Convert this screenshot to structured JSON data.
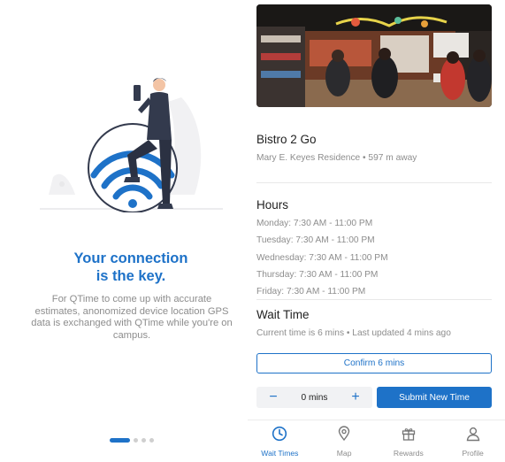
{
  "onboarding": {
    "title_line1": "Your connection",
    "title_line2": "is the key.",
    "body": "For QTime to come up with accurate estimates, anonomized device location GPS data is exchanged with QTime while you're on campus.",
    "pagination": {
      "count": 4,
      "active_index": 0
    }
  },
  "restaurant": {
    "name": "Bistro 2 Go",
    "subtitle": "Mary E. Keyes Residence • 597 m away"
  },
  "hours": {
    "heading": "Hours",
    "items": [
      "Monday: 7:30 AM - 11:00 PM",
      "Tuesday: 7:30 AM - 11:00 PM",
      "Wednesday: 7:30 AM - 11:00 PM",
      "Thursday: 7:30 AM - 11:00 PM",
      "Friday: 7:30 AM - 11:00 PM"
    ]
  },
  "wait": {
    "heading": "Wait Time",
    "info": "Current time is 6 mins • Last updated 4 mins ago",
    "confirm_label": "Confirm 6 mins",
    "stepper_minus": "−",
    "stepper_value": "0 mins",
    "stepper_plus": "+",
    "submit_label": "Submit New Time"
  },
  "tabs": [
    {
      "label": "Wait Times",
      "icon": "clock-icon",
      "active": true
    },
    {
      "label": "Map",
      "icon": "map-pin-icon",
      "active": false
    },
    {
      "label": "Rewards",
      "icon": "gift-icon",
      "active": false
    },
    {
      "label": "Profile",
      "icon": "profile-icon",
      "active": false
    }
  ],
  "colors": {
    "accent": "#1e72c8",
    "muted": "#8d8d8d"
  }
}
